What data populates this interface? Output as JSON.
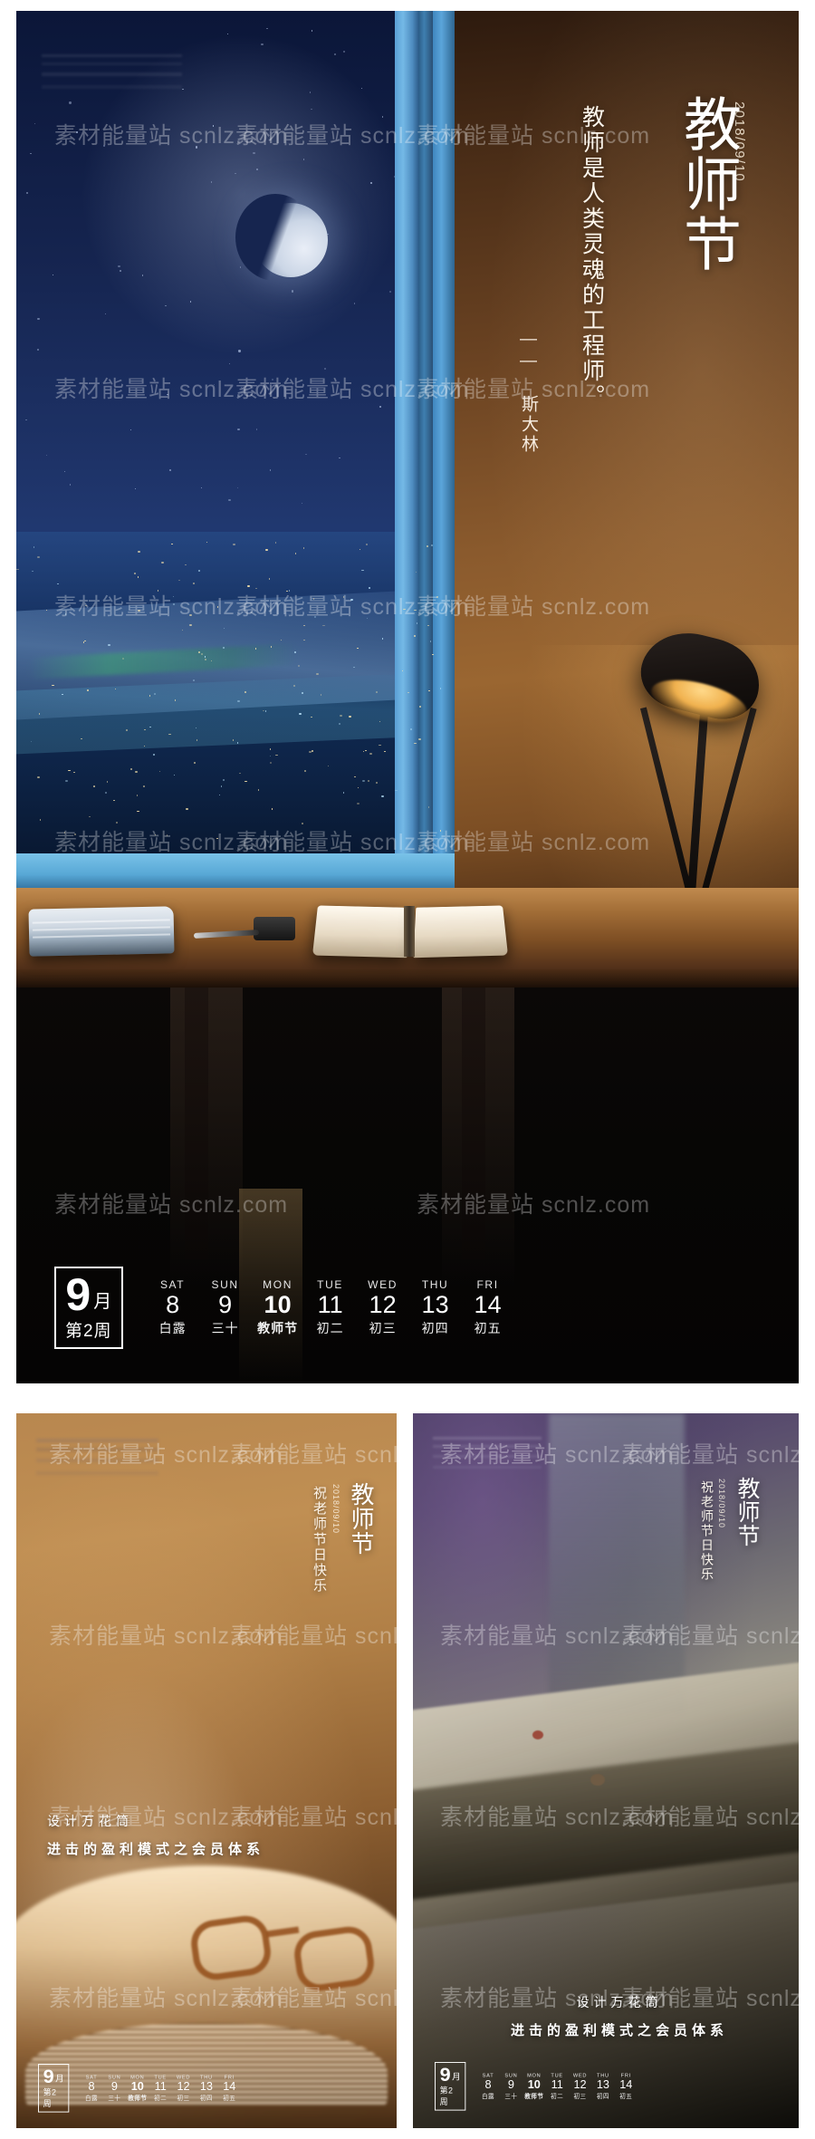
{
  "poster_main": {
    "title": "教师节",
    "date": "2018/09/10",
    "quote": "教师是人类灵魂的工程师。",
    "author": "—— 斯大林",
    "calendar": {
      "month_number": "9",
      "month_char": "月",
      "week_label": "第2周",
      "days": [
        {
          "dow": "SAT",
          "num": "8",
          "lunar": "白露",
          "highlight": false
        },
        {
          "dow": "SUN",
          "num": "9",
          "lunar": "三十",
          "highlight": false
        },
        {
          "dow": "MON",
          "num": "10",
          "lunar": "教师节",
          "highlight": true
        },
        {
          "dow": "TUE",
          "num": "11",
          "lunar": "初二",
          "highlight": false
        },
        {
          "dow": "WED",
          "num": "12",
          "lunar": "初三",
          "highlight": false
        },
        {
          "dow": "THU",
          "num": "13",
          "lunar": "初四",
          "highlight": false
        },
        {
          "dow": "FRI",
          "num": "14",
          "lunar": "初五",
          "highlight": false
        }
      ]
    }
  },
  "poster_book": {
    "title": "教师节",
    "date": "2018/09/10",
    "subtitle": "祝老师节日快乐",
    "foot_line1": "设计万花筒",
    "foot_line2": "进击的盈利模式之会员体系",
    "calendar": {
      "month_number": "9",
      "month_char": "月",
      "week_label": "第2周",
      "days": [
        {
          "dow": "SAT",
          "num": "8",
          "lunar": "白露",
          "highlight": false
        },
        {
          "dow": "SUN",
          "num": "9",
          "lunar": "三十",
          "highlight": false
        },
        {
          "dow": "MON",
          "num": "10",
          "lunar": "教师节",
          "highlight": true
        },
        {
          "dow": "TUE",
          "num": "11",
          "lunar": "初二",
          "highlight": false
        },
        {
          "dow": "WED",
          "num": "12",
          "lunar": "初三",
          "highlight": false
        },
        {
          "dow": "THU",
          "num": "13",
          "lunar": "初四",
          "highlight": false
        },
        {
          "dow": "FRI",
          "num": "14",
          "lunar": "初五",
          "highlight": false
        }
      ]
    }
  },
  "poster_desk": {
    "title": "教师节",
    "date": "2018/09/10",
    "subtitle": "祝老师节日快乐",
    "foot_line1": "设计万花筒",
    "foot_line2": "进击的盈利模式之会员体系",
    "calendar": {
      "month_number": "9",
      "month_char": "月",
      "week_label": "第2周",
      "days": [
        {
          "dow": "SAT",
          "num": "8",
          "lunar": "白露",
          "highlight": false
        },
        {
          "dow": "SUN",
          "num": "9",
          "lunar": "三十",
          "highlight": false
        },
        {
          "dow": "MON",
          "num": "10",
          "lunar": "教师节",
          "highlight": true
        },
        {
          "dow": "TUE",
          "num": "11",
          "lunar": "初二",
          "highlight": false
        },
        {
          "dow": "WED",
          "num": "12",
          "lunar": "初三",
          "highlight": false
        },
        {
          "dow": "THU",
          "num": "13",
          "lunar": "初四",
          "highlight": false
        },
        {
          "dow": "FRI",
          "num": "14",
          "lunar": "初五",
          "highlight": false
        }
      ]
    }
  },
  "watermark": {
    "text": "素材能量站 scnlz.com"
  },
  "colors": {
    "night_sky": "#1e3368",
    "warm_wall": "#8a5a2d",
    "lamp_light": "#ffd98a",
    "frame_blue": "#5a9fd4",
    "text_white": "#ffffff"
  }
}
